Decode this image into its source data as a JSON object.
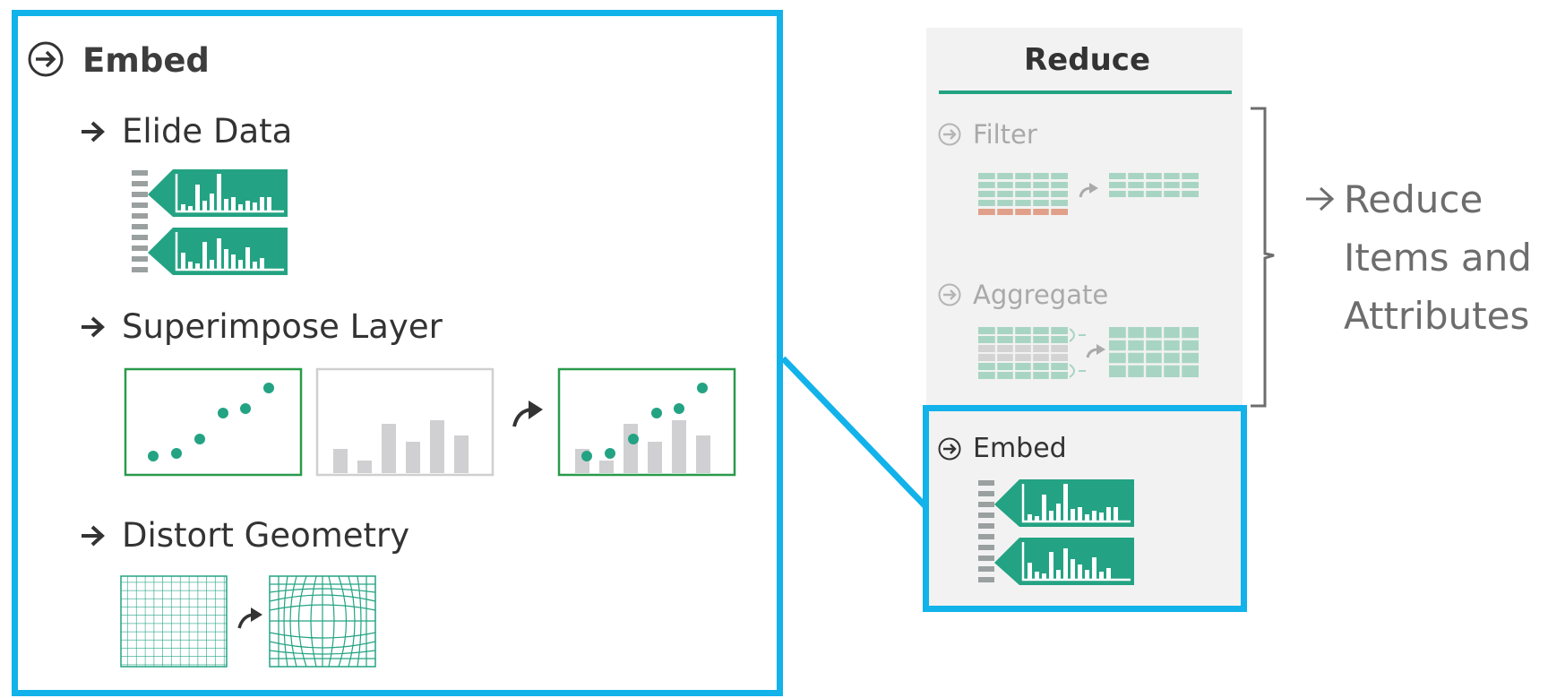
{
  "colors": {
    "accent_blue": "#12b2ea",
    "teal": "#23a383",
    "teal_light": "#a8d5c3",
    "salmon": "#e0a08a",
    "bar_gray": "#d0d0d2",
    "text_dark": "#333333",
    "text_faded": "#a9a9a9",
    "text_side": "#6d6d6d"
  },
  "embed_panel": {
    "title": "Embed",
    "title_icon": "circle-arrow-right-icon",
    "sections": [
      {
        "id": "elide",
        "title": "Elide Data",
        "bullet_icon": "arrow-right-icon"
      },
      {
        "id": "superimpose",
        "title": "Superimpose Layer",
        "bullet_icon": "arrow-right-icon"
      },
      {
        "id": "distort",
        "title": "Distort Geometry",
        "bullet_icon": "arrow-right-icon"
      }
    ]
  },
  "reduce_panel": {
    "title": "Reduce",
    "items": [
      {
        "label": "Filter",
        "icon": "circle-arrow-right-icon",
        "faded": true
      },
      {
        "label": "Aggregate",
        "icon": "circle-arrow-right-icon",
        "faded": true
      },
      {
        "label": "Embed",
        "icon": "circle-arrow-right-icon",
        "faded": false
      }
    ]
  },
  "side_label": {
    "arrow_icon": "arrow-right-icon",
    "lines": [
      "Reduce",
      "Items and",
      "Attributes"
    ]
  }
}
